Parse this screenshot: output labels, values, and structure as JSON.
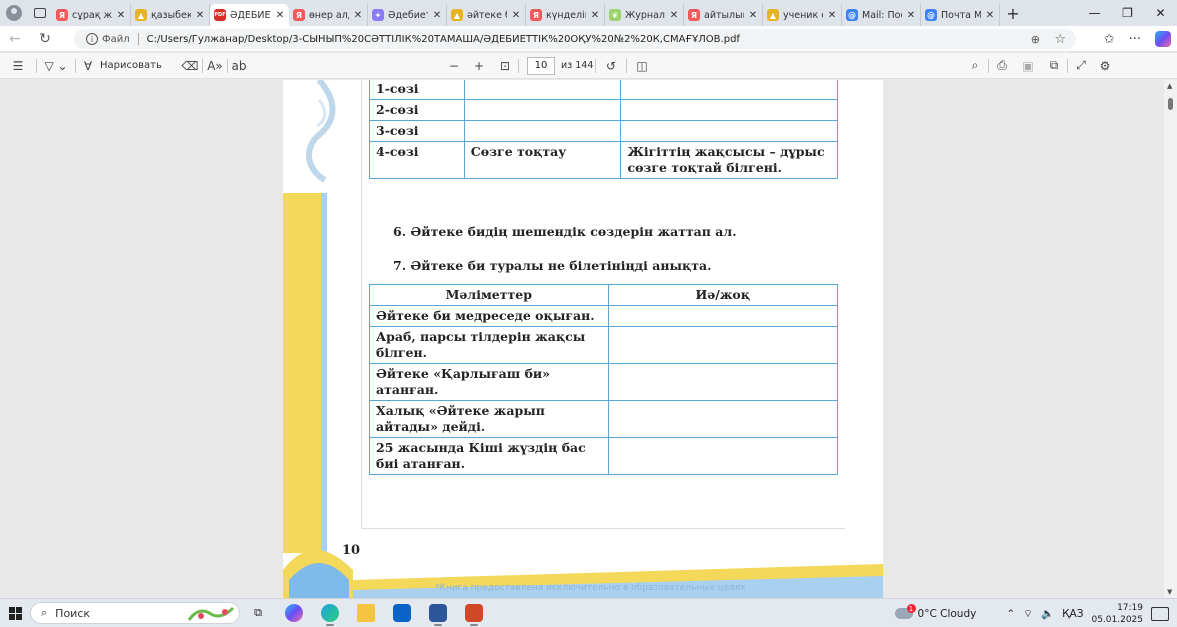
{
  "browser": {
    "tabs": [
      {
        "title": "сұрақ жа",
        "icon": "yandex-icon",
        "color": "#f25a5a",
        "glyph": "Я"
      },
      {
        "title": "қазыбек",
        "icon": "image-icon",
        "color": "#e6b422",
        "glyph": "▲"
      },
      {
        "title": "ӘДЕБИЕТ",
        "icon": "pdf-icon",
        "color": "#d93025",
        "glyph": "PDF",
        "active": true
      },
      {
        "title": "өнер алд",
        "icon": "yandex-icon",
        "color": "#f25a5a",
        "glyph": "Я"
      },
      {
        "title": "Әдебиет",
        "icon": "ai-icon",
        "color": "#8b7cf6",
        "glyph": "✦"
      },
      {
        "title": "әйтеке б",
        "icon": "image-icon",
        "color": "#e6b422",
        "glyph": "▲"
      },
      {
        "title": "күнделік",
        "icon": "yandex-icon",
        "color": "#f25a5a",
        "glyph": "Я"
      },
      {
        "title": "Журнал",
        "icon": "leaf-icon",
        "color": "#9bd36a",
        "glyph": "❦"
      },
      {
        "title": "айтылым",
        "icon": "yandex-icon",
        "color": "#f25a5a",
        "glyph": "Я"
      },
      {
        "title": "ученик с",
        "icon": "image-icon",
        "color": "#e6b422",
        "glyph": "▲"
      },
      {
        "title": "Mail: Пос",
        "icon": "mail-icon",
        "color": "#3b82f6",
        "glyph": "@"
      },
      {
        "title": "Почта М",
        "icon": "mail-icon",
        "color": "#3b82f6",
        "glyph": "@"
      }
    ],
    "url_prefix": "Файл",
    "url": "C:/Users/Гулжанар/Desktop/3-СЫНЫП%20СӘТТІЛІК%20ТАМАША/ӘДЕБИЕТТІК%20ОҚУ%20№2%20К,СМАҒҰЛОВ.pdf"
  },
  "pdf_toolbar": {
    "draw_label": "Нарисовать",
    "zoom_out": "−",
    "zoom_in": "+",
    "current_page": "10",
    "total_pages": "из 144"
  },
  "page": {
    "table1": {
      "rows": [
        [
          "1-сөзі",
          "",
          ""
        ],
        [
          "2-сөзі",
          "",
          ""
        ],
        [
          "3-сөзі",
          "",
          ""
        ],
        [
          "4-сөзі",
          "Сөзге тоқтау",
          "Жігіттің жақсысы – дұрыс сөзге тоқтай білгені."
        ]
      ]
    },
    "task6_num": "6.",
    "task6_text": "Әйтеке бидің шешендік сөздерін жаттап ал.",
    "task7_num": "7.",
    "task7_text": "Әйтеке би туралы не білетініңді анықта.",
    "table2": {
      "headers": [
        "Мәліметтер",
        "Иә/жоқ"
      ],
      "rows": [
        [
          "Әйтеке би медреседе оқыған.",
          ""
        ],
        [
          "Араб, парсы тілдерін жақсы білген.",
          ""
        ],
        [
          "Әйтеке «Қарлығаш би» атанған.",
          ""
        ],
        [
          "Халық «Әйтеке жарып айтады» дейді.",
          ""
        ],
        [
          "25 жасында Кіші жүздің бас биі атанған.",
          ""
        ]
      ]
    },
    "page_number": "10",
    "watermark": "*Книга предоставлена исключительно в образовательных целях"
  },
  "taskbar": {
    "search_placeholder": "Поиск",
    "weather": "0°C  Cloudy",
    "weather_badge": "1",
    "lang": "ҚАЗ",
    "time": "17:19",
    "date": "05.01.2025"
  }
}
